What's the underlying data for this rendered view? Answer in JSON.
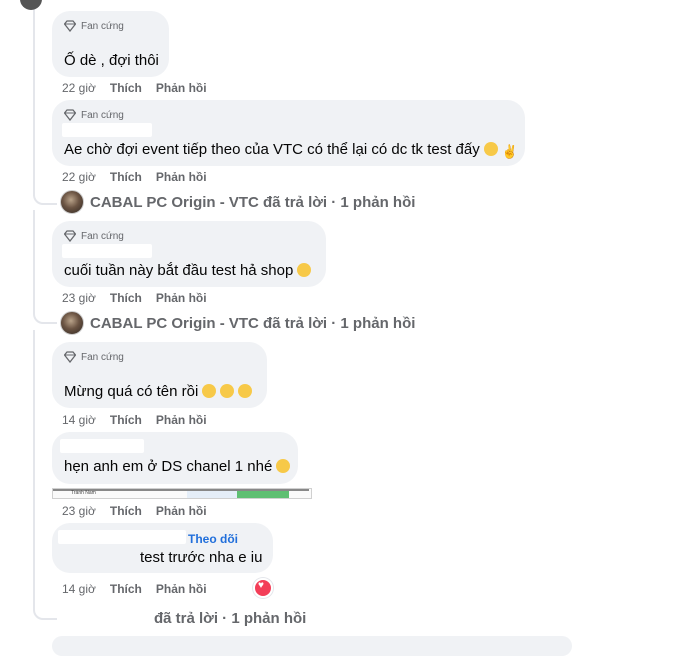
{
  "comments": [
    {
      "badge": "Fan cứng",
      "text": "Ố dè , đợi thôi",
      "time": "22 giờ",
      "like": "Thích",
      "reply": "Phản hồi"
    },
    {
      "badge": "Fan cứng",
      "text": "Ae chờ đợi event tiếp theo của VTC có thể lại có dc tk test đấy",
      "time": "22 giờ",
      "like": "Thích",
      "reply": "Phản hồi",
      "replied": "CABAL PC Origin - VTC đã trả lời · 1 phản hồi"
    },
    {
      "badge": "Fan cứng",
      "text": "cuối tuần này bắt đầu test hả shop",
      "time": "23 giờ",
      "like": "Thích",
      "reply": "Phản hồi",
      "replied": "CABAL PC Origin - VTC đã trả lời · 1 phản hồi"
    },
    {
      "badge": "Fan cứng",
      "text": "Mừng quá có tên rồi",
      "time": "14 giờ",
      "like": "Thích",
      "reply": "Phản hồi"
    },
    {
      "text": "hẹn anh em ở DS chanel 1 nhé",
      "time": "23 giờ",
      "like": "Thích",
      "reply": "Phản hồi",
      "attachment_text": "Tránh Nam"
    },
    {
      "follow": "Theo dõi",
      "text": "test trước nha e iu",
      "time": "14 giờ",
      "like": "Thích",
      "reply": "Phản hồi",
      "replied": "đã trả lời · 1 phản hồi"
    }
  ],
  "colors": {
    "bubble": "#f0f2f5",
    "meta": "#65676b",
    "link": "#216fdb",
    "heart": "#f33e58"
  }
}
